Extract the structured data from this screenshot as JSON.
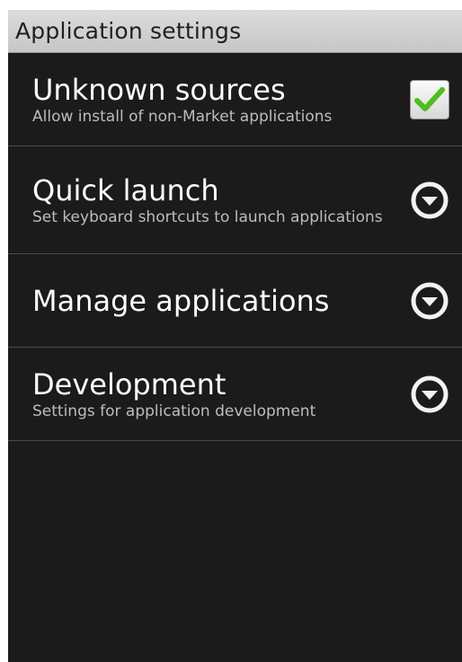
{
  "header": {
    "title": "Application settings"
  },
  "items": [
    {
      "title": "Unknown sources",
      "summary": "Allow install of non-Market applications",
      "widget": "checkbox",
      "checked": true,
      "icon": "checkmark-icon",
      "check_color": "#4cbf1f"
    },
    {
      "title": "Quick launch",
      "summary": "Set keyboard shortcuts to launch applications",
      "widget": "chevron",
      "icon": "chevron-down-circle-icon"
    },
    {
      "title": "Manage applications",
      "summary": "",
      "widget": "chevron",
      "icon": "chevron-down-circle-icon"
    },
    {
      "title": "Development",
      "summary": "Settings for application development",
      "widget": "chevron",
      "icon": "chevron-down-circle-icon"
    }
  ],
  "colors": {
    "background": "#1b1b1b",
    "title_bar": "#d0d0d0",
    "divider": "#4a4a4a",
    "primary_text": "#ffffff",
    "secondary_text": "#bdbdbd"
  }
}
